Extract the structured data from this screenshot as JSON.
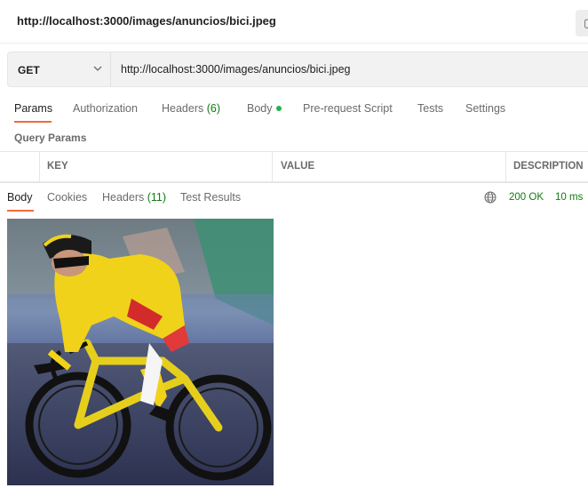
{
  "window": {
    "title": "http://localhost:3000/images/anuncios/bici.jpeg",
    "save_icon": "doc-icon"
  },
  "request": {
    "method": "GET",
    "url": "http://localhost:3000/images/anuncios/bici.jpeg",
    "tabs": [
      {
        "label": "Params"
      },
      {
        "label": "Authorization"
      },
      {
        "label": "Headers",
        "count": "(6)"
      },
      {
        "label": "Body"
      },
      {
        "label": "Pre-request Script"
      },
      {
        "label": "Tests"
      },
      {
        "label": "Settings"
      }
    ]
  },
  "params": {
    "section_title": "Query Params",
    "columns": [
      "KEY",
      "VALUE",
      "DESCRIPTION"
    ]
  },
  "response": {
    "tabs": [
      {
        "label": "Body"
      },
      {
        "label": "Cookies"
      },
      {
        "label": "Headers",
        "count": "(11)"
      },
      {
        "label": "Test Results"
      }
    ],
    "status": "200 OK",
    "time": "10 ms",
    "image": {
      "subject": "cyclist in yellow jersey on yellow road bike"
    }
  },
  "colors": {
    "accent": "#f26b3a",
    "success": "#0f7b0f",
    "jersey": "#f0d21a",
    "background": "#ffffff"
  }
}
